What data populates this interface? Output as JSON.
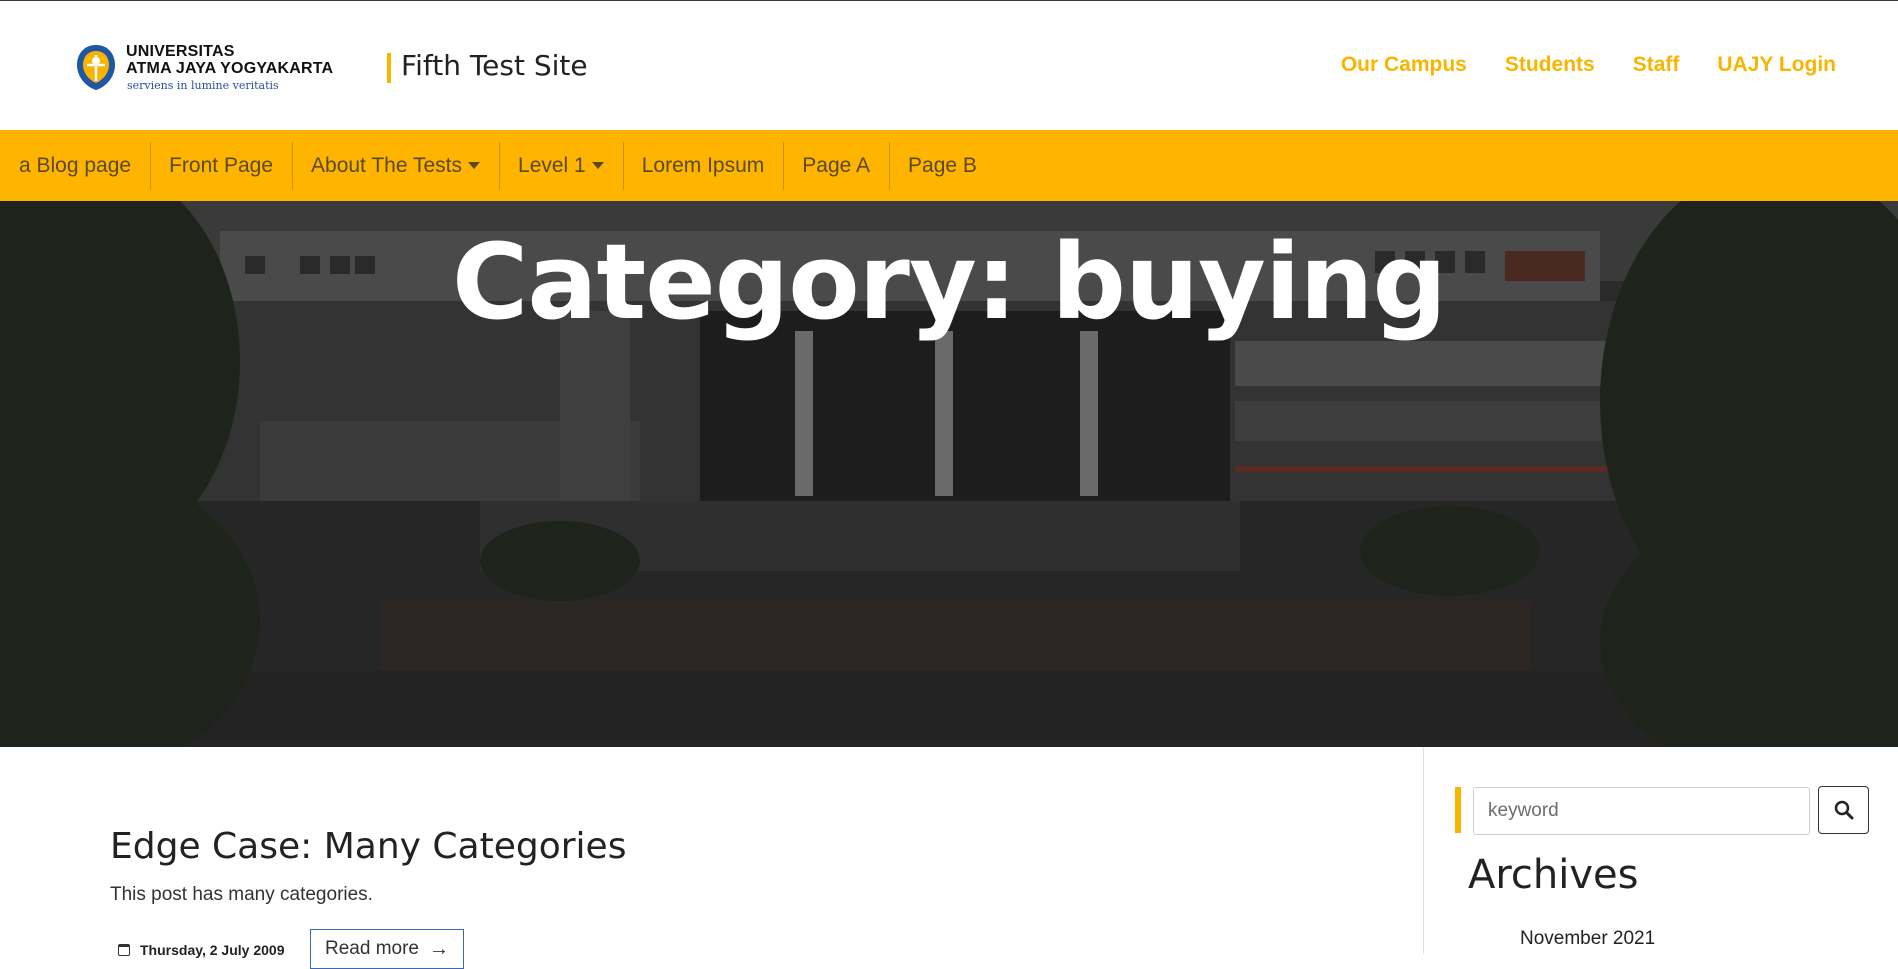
{
  "brand": {
    "logo_line1": "UNIVERSITAS",
    "logo_line2": "ATMA JAYA YOGYAKARTA",
    "logo_tagline": "serviens in lumine veritatis",
    "site_title": "Fifth Test Site",
    "accent_color": "#ffb400"
  },
  "top_nav": [
    {
      "label": "Our Campus"
    },
    {
      "label": "Students"
    },
    {
      "label": "Staff"
    },
    {
      "label": "UAJY Login"
    }
  ],
  "menu": [
    {
      "label": "a Blog page",
      "dropdown": false
    },
    {
      "label": "Front Page",
      "dropdown": false
    },
    {
      "label": "About The Tests",
      "dropdown": true
    },
    {
      "label": "Level 1",
      "dropdown": true
    },
    {
      "label": "Lorem Ipsum",
      "dropdown": false
    },
    {
      "label": "Page A",
      "dropdown": false
    },
    {
      "label": "Page B",
      "dropdown": false
    }
  ],
  "hero": {
    "title": "Category: buying"
  },
  "post": {
    "title": "Edge Case: Many Categories",
    "excerpt": "This post has many categories.",
    "date": "Thursday, 2 July 2009",
    "read_more": "Read more"
  },
  "sidebar": {
    "search_placeholder": "keyword",
    "archives_title": "Archives",
    "archive_items": [
      "November 2021"
    ]
  }
}
